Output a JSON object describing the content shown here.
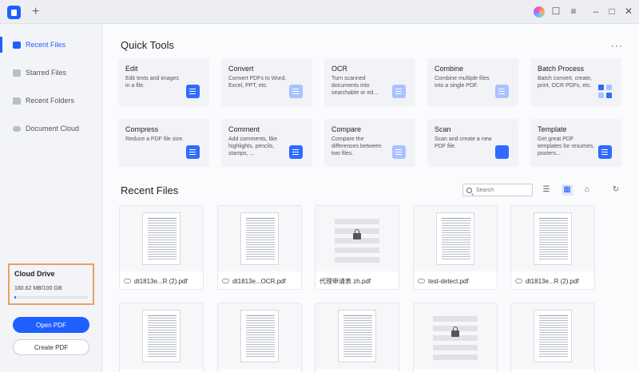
{
  "sidebar": {
    "items": [
      {
        "label": "Recent Files",
        "icon": "recent-files-icon",
        "active": true
      },
      {
        "label": "Starred Files",
        "icon": "star-icon",
        "active": false
      },
      {
        "label": "Recent Folders",
        "icon": "folder-icon",
        "active": false
      },
      {
        "label": "Document Cloud",
        "icon": "cloud-icon",
        "active": false
      }
    ],
    "cloud_drive": {
      "title": "Cloud Drive",
      "usage": "180.62 MB/100 GB",
      "used_fraction": 0.0018
    },
    "open_pdf_label": "Open PDF",
    "create_pdf_label": "Create PDF"
  },
  "quick_tools": {
    "title": "Quick Tools",
    "more": "···",
    "tools": [
      {
        "title": "Edit",
        "desc": "Edit texts and images in a file.",
        "icon": "edit-icon"
      },
      {
        "title": "Convert",
        "desc": "Convert PDFs to Word, Excel, PPT, etc.",
        "icon": "convert-icon"
      },
      {
        "title": "OCR",
        "desc": "Turn scanned documents into searchable or ed...",
        "icon": "ocr-icon"
      },
      {
        "title": "Combine",
        "desc": "Combine multiple files into a single PDF.",
        "icon": "combine-icon"
      },
      {
        "title": "Batch Process",
        "desc": "Batch convert, create, print, OCR PDFs, etc.",
        "icon": "batch-process-icon"
      },
      {
        "title": "Compress",
        "desc": "Reduce a PDF file size.",
        "icon": "compress-icon"
      },
      {
        "title": "Comment",
        "desc": "Add comments, like highlights, pencils, stamps, ...",
        "icon": "comment-icon"
      },
      {
        "title": "Compare",
        "desc": "Compare the differences between two files.",
        "icon": "compare-icon"
      },
      {
        "title": "Scan",
        "desc": "Scan and create a new PDF file.",
        "icon": "scan-icon"
      },
      {
        "title": "Template",
        "desc": "Get great PDF templates for resumes, posters...",
        "icon": "template-icon"
      }
    ]
  },
  "recent": {
    "title": "Recent Files",
    "search_placeholder": "Search",
    "files": [
      {
        "name": "dt1813e...R (2).pdf",
        "locked": false
      },
      {
        "name": "dt1813e...OCR.pdf",
        "locked": false
      },
      {
        "name": "代理申请表 zh.pdf",
        "locked": true
      },
      {
        "name": "test-detect.pdf",
        "locked": false
      },
      {
        "name": "dt1813e...R (2).pdf",
        "locked": false
      },
      {
        "name": "",
        "locked": false
      },
      {
        "name": "",
        "locked": false
      },
      {
        "name": "",
        "locked": false
      },
      {
        "name": "",
        "locked": true
      },
      {
        "name": "",
        "locked": false
      }
    ]
  },
  "colors": {
    "accent": "#1f5fff",
    "highlight_border": "#e8a160"
  }
}
